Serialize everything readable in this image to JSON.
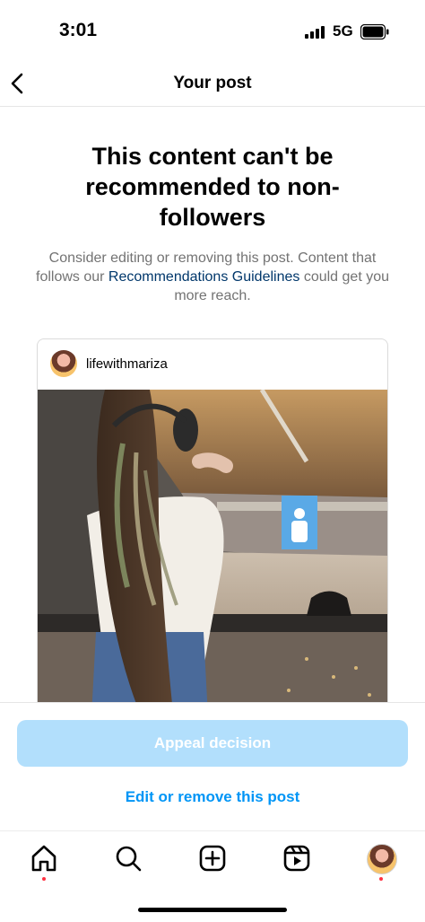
{
  "status": {
    "time": "3:01",
    "network": "5G"
  },
  "nav": {
    "title": "Your post"
  },
  "notice": {
    "headline": "This content can't be recommended to non-followers",
    "desc_before": "Consider editing or removing this post. Content that follows our ",
    "desc_link": "Recommendations Guidelines",
    "desc_after": " could get you more reach."
  },
  "post": {
    "username": "lifewithmariza"
  },
  "actions": {
    "appeal_label": "Appeal decision",
    "edit_label": "Edit or remove this post"
  },
  "tabbar": {
    "items": [
      "home-icon",
      "search-icon",
      "create-icon",
      "reels-icon",
      "profile-avatar"
    ]
  },
  "colors": {
    "primary_blue": "#0095f6",
    "disabled_blue": "#b2dffc",
    "link_blue": "#00376b",
    "notification_red": "#ff3040"
  }
}
